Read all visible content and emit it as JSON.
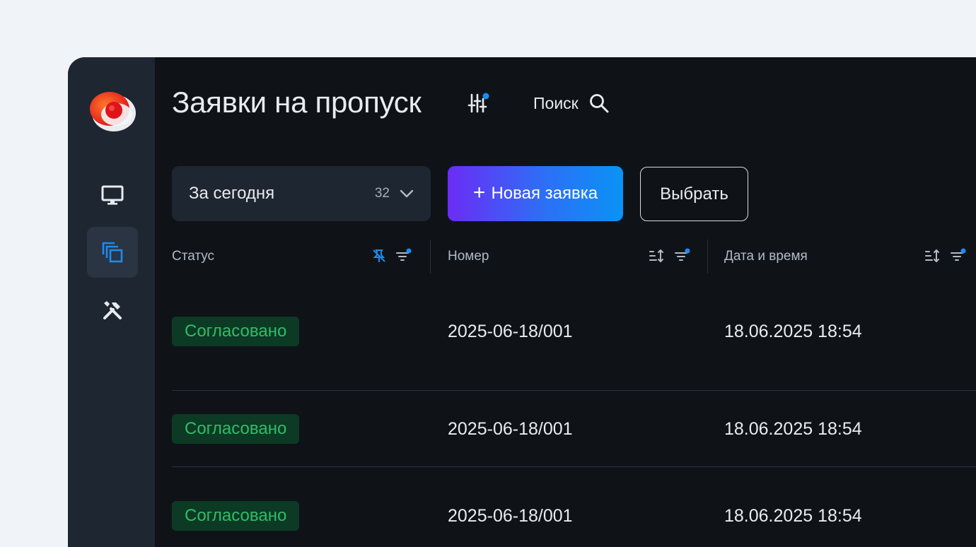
{
  "header": {
    "title": "Заявки на пропуск",
    "search_label": "Поиск"
  },
  "toolbar": {
    "period_label": "За сегодня",
    "period_count": "32",
    "new_request_label": "Новая заявка",
    "select_label": "Выбрать"
  },
  "table": {
    "columns": [
      "Статус",
      "Номер",
      "Дата и время"
    ],
    "rows": [
      {
        "status": "Согласовано",
        "number": "2025-06-18/001",
        "datetime": "18.06.2025 18:54"
      },
      {
        "status": "Согласовано",
        "number": "2025-06-18/001",
        "datetime": "18.06.2025 18:54"
      },
      {
        "status": "Согласовано",
        "number": "2025-06-18/001",
        "datetime": "18.06.2025 18:54"
      }
    ]
  },
  "sidebar": {
    "items": [
      {
        "icon": "monitor-icon"
      },
      {
        "icon": "copy-windows-icon",
        "active": true
      },
      {
        "icon": "tools-icon"
      }
    ]
  },
  "colors": {
    "accent": "#0a93f5",
    "status_approved_text": "#2fbd69",
    "status_approved_bg": "#0c3a24"
  }
}
